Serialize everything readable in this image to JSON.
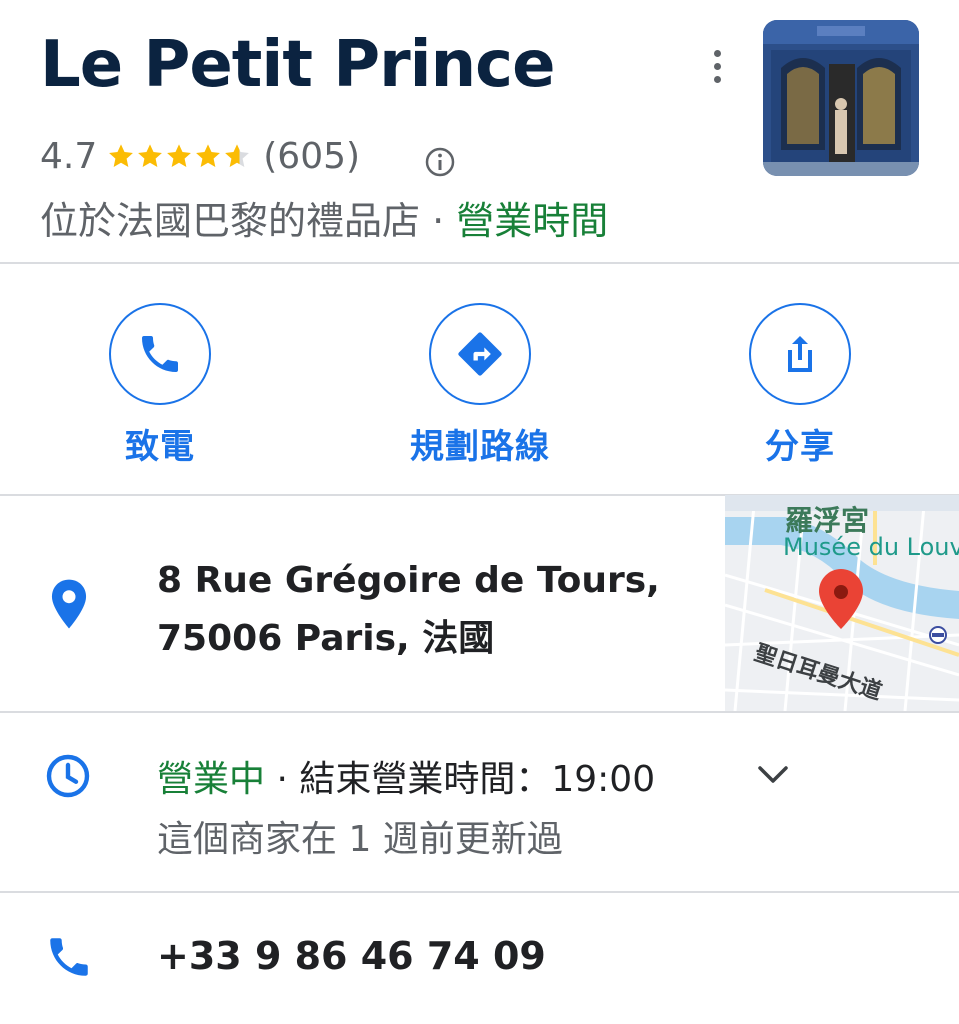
{
  "place": {
    "name": "Le Petit Prince",
    "rating": "4.7",
    "rating_value": 4.7,
    "review_count": "(605)",
    "category": "位於法國巴黎的禮品店",
    "separator": " · ",
    "hours_link": "營業時間"
  },
  "actions": [
    {
      "label": "致電",
      "icon": "phone-icon"
    },
    {
      "label": "規劃路線",
      "icon": "directions-icon"
    },
    {
      "label": "分享",
      "icon": "share-icon"
    }
  ],
  "address": {
    "line1": "8 Rue Grégoire de Tours,",
    "line2": "75006 Paris, 法國",
    "icon": "location-pin-icon"
  },
  "map": {
    "label_top_zh": "羅浮宮",
    "label_top_en": "Musée du Louv",
    "label_street": "聖日耳曼大道"
  },
  "hours": {
    "status": "營業中",
    "detail": " · 結束營業時間：19:00",
    "updated": "這個商家在 1 週前更新過",
    "icon": "clock-icon"
  },
  "phone": {
    "number": "+33 9 86 46 74 09",
    "icon": "phone-icon"
  },
  "colors": {
    "accent_blue": "#1a73e8",
    "open_green": "#188038",
    "star_yellow": "#fbbc04",
    "title_navy": "#0b2340",
    "pin_red": "#ea4335"
  }
}
